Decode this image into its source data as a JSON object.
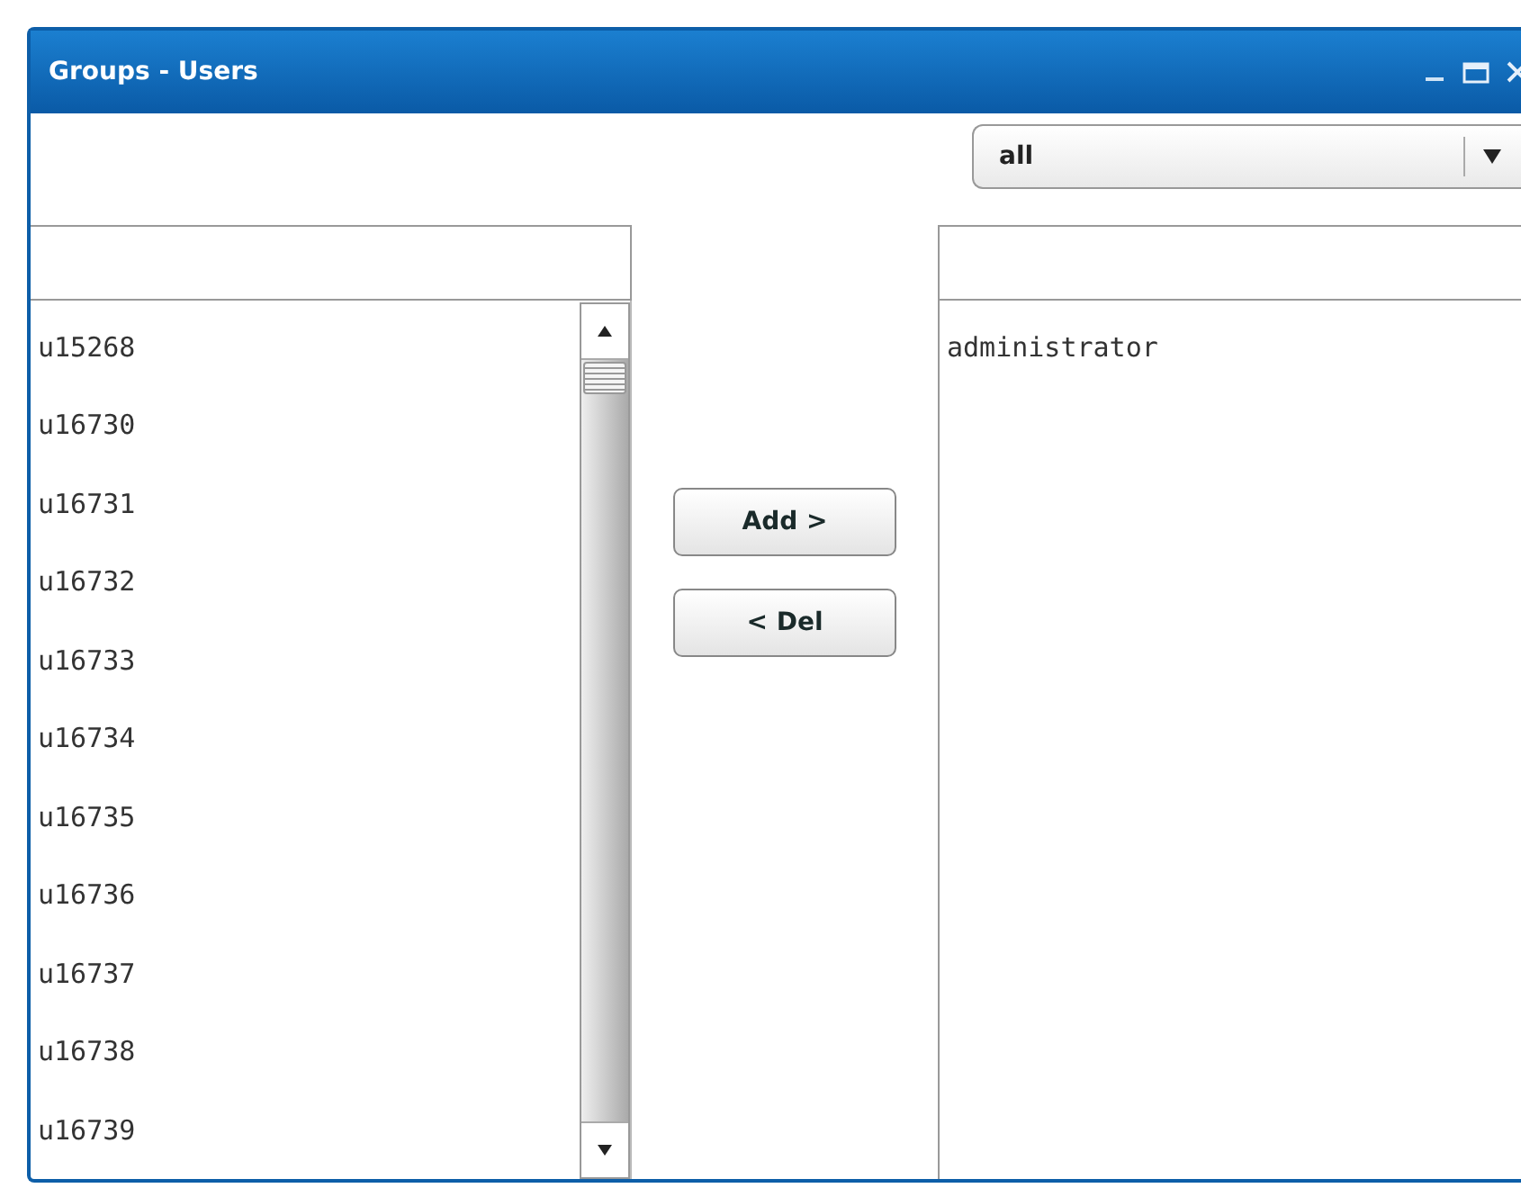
{
  "window": {
    "title": "Groups - Users"
  },
  "filter": {
    "value": "all"
  },
  "available_users": [
    "u15268",
    "u16730",
    "u16731",
    "u16732",
    "u16733",
    "u16734",
    "u16735",
    "u16736",
    "u16737",
    "u16738",
    "u16739"
  ],
  "buttons": [
    "Add >",
    "< Del"
  ],
  "group_users": [
    "administrator"
  ]
}
